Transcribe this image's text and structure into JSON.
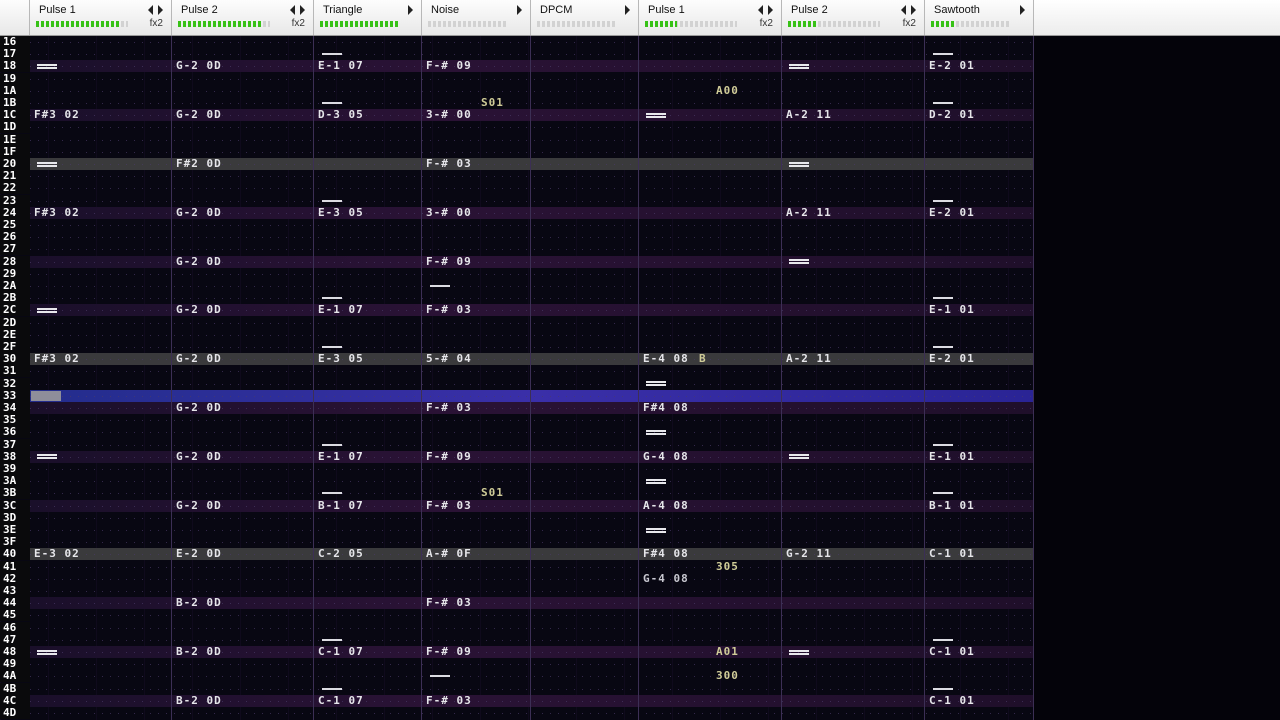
{
  "channels": [
    {
      "name": "Pulse 1",
      "fx": "fx2",
      "level": 0.92
    },
    {
      "name": "Pulse 2",
      "fx": "fx2",
      "level": 0.92
    },
    {
      "name": "Triangle",
      "fx": "",
      "level": 1.0
    },
    {
      "name": "Noise",
      "fx": "",
      "level": 0.0
    },
    {
      "name": "DPCM",
      "fx": "",
      "level": 0.0
    },
    {
      "name": "Pulse 1",
      "fx": "fx2",
      "level": 0.35
    },
    {
      "name": "Pulse 2",
      "fx": "fx2",
      "level": 0.3
    },
    {
      "name": "Sawtooth",
      "fx": "",
      "level": 0.3
    }
  ],
  "row_numbers": [
    "16",
    "17",
    "18",
    "19",
    "1A",
    "1B",
    "1C",
    "1D",
    "1E",
    "1F",
    "20",
    "21",
    "22",
    "23",
    "24",
    "25",
    "26",
    "27",
    "28",
    "29",
    "2A",
    "2B",
    "2C",
    "2D",
    "2E",
    "2F",
    "30",
    "31",
    "32",
    "33",
    "34",
    "35",
    "36",
    "37",
    "38",
    "39",
    "3A",
    "3B",
    "3C",
    "3D",
    "3E",
    "3F",
    "40",
    "41",
    "42",
    "43",
    "44",
    "45",
    "46",
    "47",
    "48",
    "49",
    "4A",
    "4B",
    "4C",
    "4D"
  ],
  "row_styles": {
    "highlight_beat": [
      "18",
      "1C",
      "24",
      "28",
      "2C",
      "34",
      "38",
      "3C",
      "44",
      "48",
      "4C"
    ],
    "highlight_measure": [
      "20",
      "30",
      "40"
    ],
    "cursor": "33"
  },
  "cells": [
    {
      "row": "18",
      "ch": 1,
      "text": "G-2 0D"
    },
    {
      "row": "18",
      "ch": 2,
      "text": "E-1 07"
    },
    {
      "row": "18",
      "ch": 3,
      "text": "F-# 09"
    },
    {
      "row": "18",
      "ch": 7,
      "text": "E-2 01"
    },
    {
      "row": "1A",
      "ch": 5,
      "text": "A00",
      "fx": true
    },
    {
      "row": "1B",
      "ch": 3,
      "text": "S01",
      "fx": true
    },
    {
      "row": "1C",
      "ch": 0,
      "text": "F#3 02"
    },
    {
      "row": "1C",
      "ch": 1,
      "text": "G-2 0D"
    },
    {
      "row": "1C",
      "ch": 2,
      "text": "D-3 05"
    },
    {
      "row": "1C",
      "ch": 3,
      "text": "3-# 00"
    },
    {
      "row": "1C",
      "ch": 6,
      "text": "A-2 11"
    },
    {
      "row": "1C",
      "ch": 7,
      "text": "D-2 01"
    },
    {
      "row": "20",
      "ch": 1,
      "text": "F#2 0D"
    },
    {
      "row": "20",
      "ch": 3,
      "text": "F-# 03"
    },
    {
      "row": "24",
      "ch": 0,
      "text": "F#3 02"
    },
    {
      "row": "24",
      "ch": 1,
      "text": "G-2 0D"
    },
    {
      "row": "24",
      "ch": 2,
      "text": "E-3 05"
    },
    {
      "row": "24",
      "ch": 3,
      "text": "3-# 00"
    },
    {
      "row": "24",
      "ch": 6,
      "text": "A-2 11"
    },
    {
      "row": "24",
      "ch": 7,
      "text": "E-2 01"
    },
    {
      "row": "28",
      "ch": 1,
      "text": "G-2 0D"
    },
    {
      "row": "28",
      "ch": 3,
      "text": "F-# 09"
    },
    {
      "row": "2C",
      "ch": 1,
      "text": "G-2 0D"
    },
    {
      "row": "2C",
      "ch": 2,
      "text": "E-1 07"
    },
    {
      "row": "2C",
      "ch": 3,
      "text": "F-# 03"
    },
    {
      "row": "2C",
      "ch": 7,
      "text": "E-1 01"
    },
    {
      "row": "30",
      "ch": 0,
      "text": "F#3 02"
    },
    {
      "row": "30",
      "ch": 1,
      "text": "G-2 0D"
    },
    {
      "row": "30",
      "ch": 2,
      "text": "E-3 05"
    },
    {
      "row": "30",
      "ch": 3,
      "text": "5-# 04"
    },
    {
      "row": "30",
      "ch": 5,
      "text": "E-4 08"
    },
    {
      "row": "30",
      "ch": 5,
      "text": "B",
      "fx": true,
      "offset": 60
    },
    {
      "row": "30",
      "ch": 6,
      "text": "A-2 11"
    },
    {
      "row": "30",
      "ch": 7,
      "text": "E-2 01"
    },
    {
      "row": "34",
      "ch": 1,
      "text": "G-2 0D"
    },
    {
      "row": "34",
      "ch": 3,
      "text": "F-# 03"
    },
    {
      "row": "34",
      "ch": 5,
      "text": "F#4 08"
    },
    {
      "row": "38",
      "ch": 1,
      "text": "G-2 0D"
    },
    {
      "row": "38",
      "ch": 2,
      "text": "E-1 07"
    },
    {
      "row": "38",
      "ch": 3,
      "text": "F-# 09"
    },
    {
      "row": "38",
      "ch": 5,
      "text": "G-4 08"
    },
    {
      "row": "38",
      "ch": 7,
      "text": "E-1 01"
    },
    {
      "row": "3B",
      "ch": 3,
      "text": "S01",
      "fx": true
    },
    {
      "row": "3C",
      "ch": 1,
      "text": "G-2 0D"
    },
    {
      "row": "3C",
      "ch": 2,
      "text": "B-1 07"
    },
    {
      "row": "3C",
      "ch": 3,
      "text": "F-# 03"
    },
    {
      "row": "3C",
      "ch": 5,
      "text": "A-4 08"
    },
    {
      "row": "3C",
      "ch": 7,
      "text": "B-1 01"
    },
    {
      "row": "40",
      "ch": 0,
      "text": "E-3 02"
    },
    {
      "row": "40",
      "ch": 1,
      "text": "E-2 0D"
    },
    {
      "row": "40",
      "ch": 2,
      "text": "C-2 05"
    },
    {
      "row": "40",
      "ch": 3,
      "text": "A-# 0F"
    },
    {
      "row": "40",
      "ch": 5,
      "text": "F#4 08"
    },
    {
      "row": "40",
      "ch": 6,
      "text": "G-2 11"
    },
    {
      "row": "40",
      "ch": 7,
      "text": "C-1 01"
    },
    {
      "row": "41",
      "ch": 5,
      "text": "305",
      "fx": true
    },
    {
      "row": "42",
      "ch": 5,
      "text": "G-4 08",
      "dim": true
    },
    {
      "row": "44",
      "ch": 1,
      "text": "B-2 0D"
    },
    {
      "row": "44",
      "ch": 3,
      "text": "F-# 03"
    },
    {
      "row": "48",
      "ch": 1,
      "text": "B-2 0D"
    },
    {
      "row": "48",
      "ch": 2,
      "text": "C-1 07"
    },
    {
      "row": "48",
      "ch": 3,
      "text": "F-# 09"
    },
    {
      "row": "48",
      "ch": 5,
      "text": "A01",
      "fx": true
    },
    {
      "row": "48",
      "ch": 7,
      "text": "C-1 01"
    },
    {
      "row": "4A",
      "ch": 5,
      "text": "300",
      "fx": true
    },
    {
      "row": "4C",
      "ch": 1,
      "text": "B-2 0D"
    },
    {
      "row": "4C",
      "ch": 2,
      "text": "C-1 07"
    },
    {
      "row": "4C",
      "ch": 3,
      "text": "F-# 03"
    },
    {
      "row": "4C",
      "ch": 7,
      "text": "C-1 01"
    }
  ],
  "note_offs": [
    {
      "row": "18",
      "ch": 0
    },
    {
      "row": "18",
      "ch": 6
    },
    {
      "row": "1C",
      "ch": 5
    },
    {
      "row": "20",
      "ch": 0
    },
    {
      "row": "20",
      "ch": 6
    },
    {
      "row": "28",
      "ch": 6
    },
    {
      "row": "2C",
      "ch": 0
    },
    {
      "row": "32",
      "ch": 5
    },
    {
      "row": "36",
      "ch": 5
    },
    {
      "row": "38",
      "ch": 0
    },
    {
      "row": "38",
      "ch": 6
    },
    {
      "row": "3A",
      "ch": 5
    },
    {
      "row": "3E",
      "ch": 5
    },
    {
      "row": "48",
      "ch": 0
    },
    {
      "row": "48",
      "ch": 6
    }
  ],
  "releases": [
    {
      "row": "17",
      "ch": 2
    },
    {
      "row": "17",
      "ch": 7
    },
    {
      "row": "1B",
      "ch": 2
    },
    {
      "row": "1B",
      "ch": 7
    },
    {
      "row": "23",
      "ch": 2
    },
    {
      "row": "23",
      "ch": 7
    },
    {
      "row": "2A",
      "ch": 3
    },
    {
      "row": "2B",
      "ch": 2
    },
    {
      "row": "2B",
      "ch": 7
    },
    {
      "row": "2F",
      "ch": 2
    },
    {
      "row": "2F",
      "ch": 7
    },
    {
      "row": "37",
      "ch": 2
    },
    {
      "row": "37",
      "ch": 7
    },
    {
      "row": "3B",
      "ch": 2
    },
    {
      "row": "3B",
      "ch": 7
    },
    {
      "row": "47",
      "ch": 2
    },
    {
      "row": "47",
      "ch": 7
    },
    {
      "row": "4A",
      "ch": 3
    },
    {
      "row": "4B",
      "ch": 2
    },
    {
      "row": "4B",
      "ch": 7
    }
  ]
}
